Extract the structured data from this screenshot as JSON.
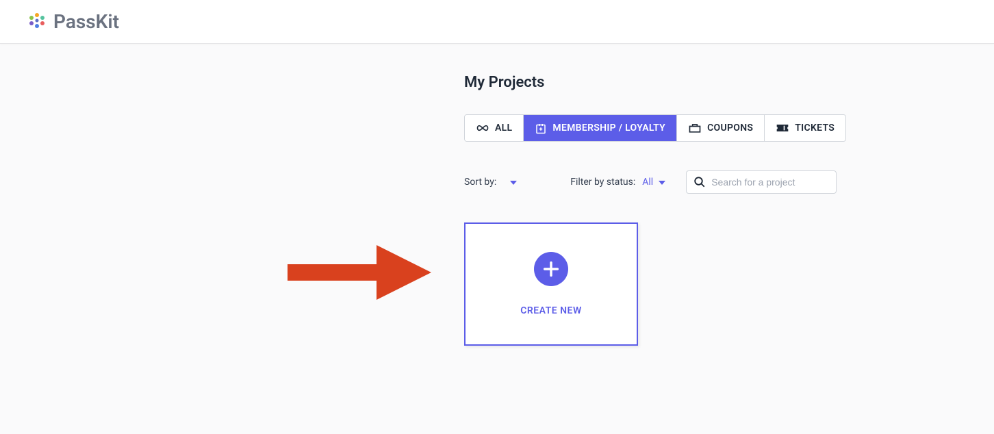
{
  "brand": {
    "name": "PassKit"
  },
  "page": {
    "title": "My Projects"
  },
  "tabs": {
    "all": "ALL",
    "membership": "MEMBERSHIP / LOYALTY",
    "coupons": "COUPONS",
    "tickets": "TICKETS",
    "activeIndex": 1
  },
  "controls": {
    "sortByLabel": "Sort by:",
    "filterLabel": "Filter by status:",
    "filterValue": "All",
    "searchPlaceholder": "Search for a project"
  },
  "card": {
    "createLabel": "CREATE NEW"
  }
}
